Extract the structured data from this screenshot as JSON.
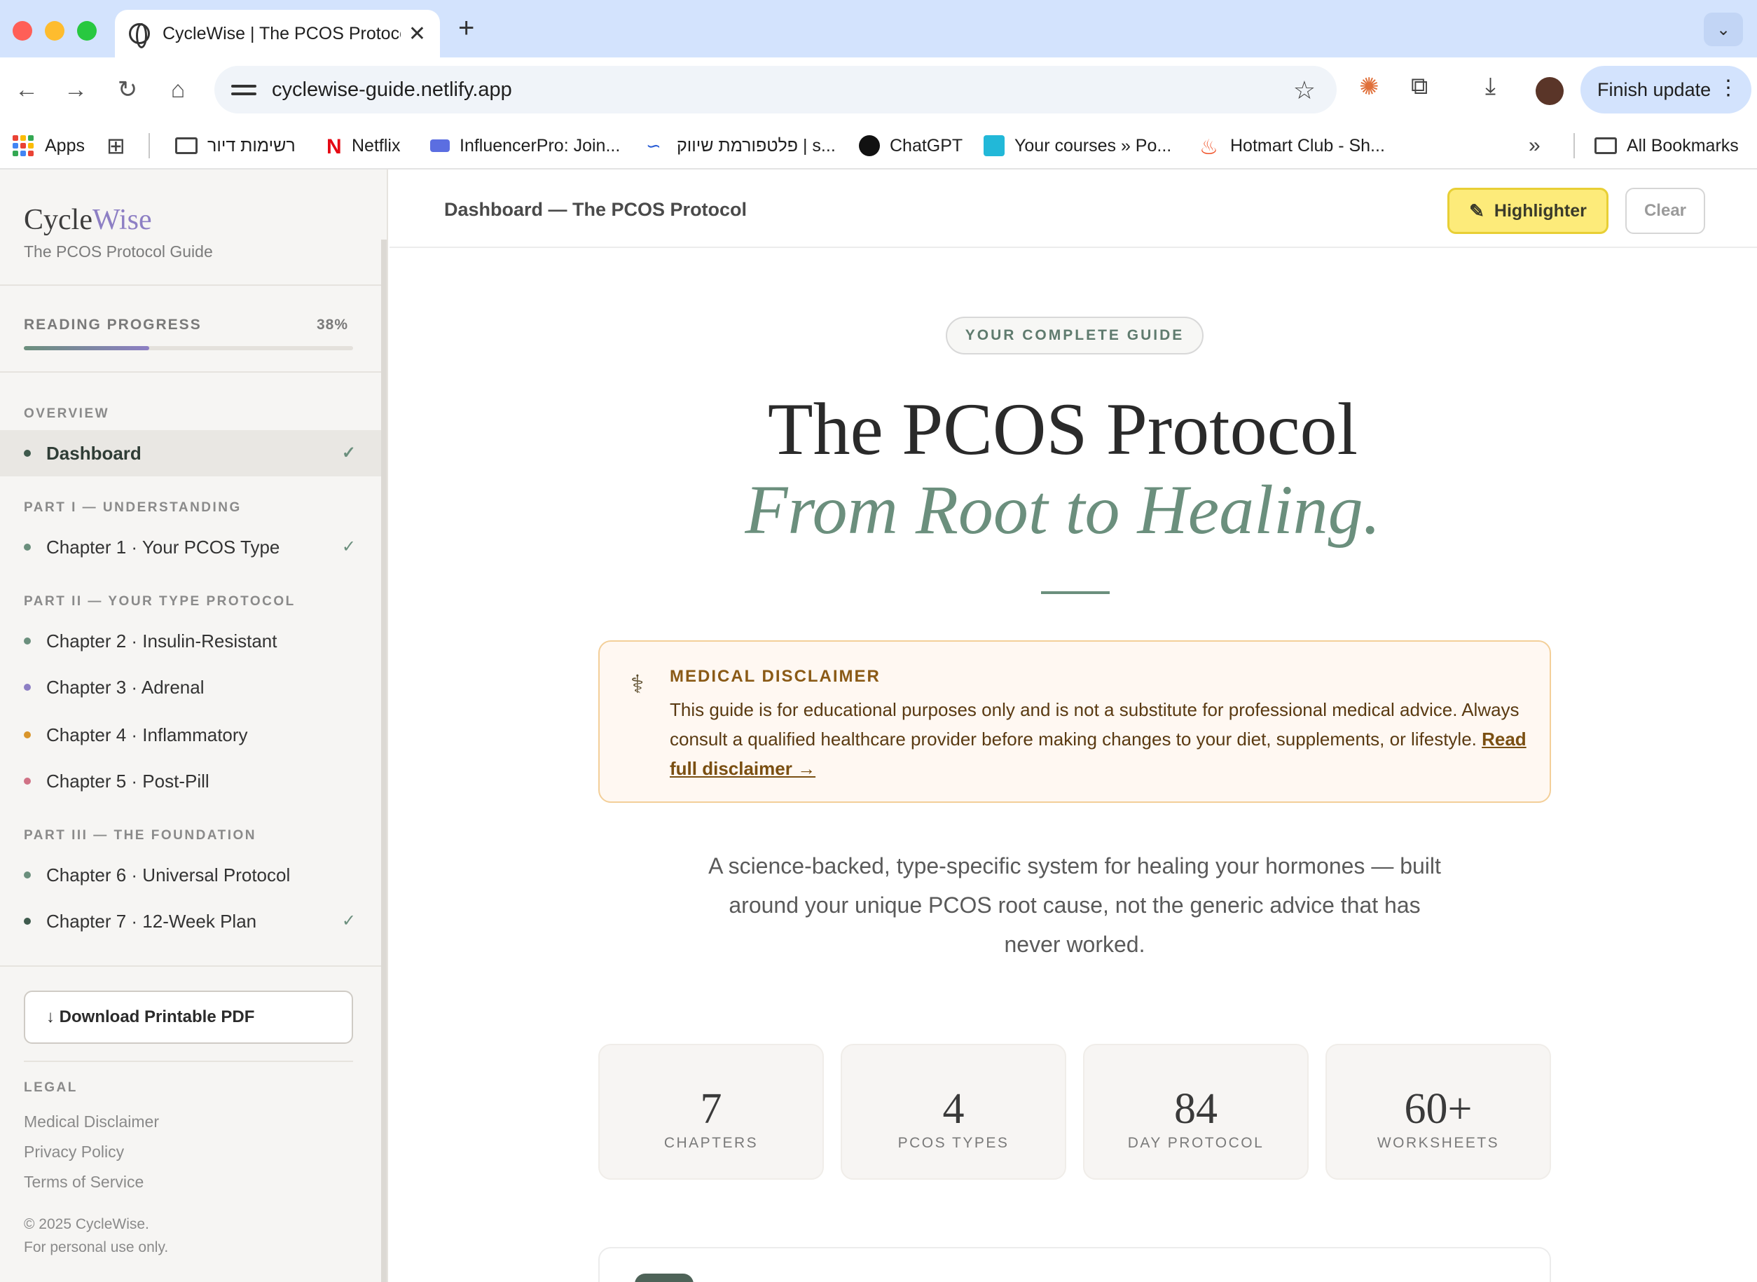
{
  "browser": {
    "tab_title": "CycleWise | The PCOS Protocol",
    "url": "cyclewise-guide.netlify.app",
    "finish_update": "Finish update",
    "bookmarks": [
      {
        "label": "Apps"
      },
      {
        "label": "רשימות דיור"
      },
      {
        "label": "Netflix"
      },
      {
        "label": "InfluencerPro: Join..."
      },
      {
        "label": "פלטפורמת שיווק | s..."
      },
      {
        "label": "ChatGPT"
      },
      {
        "label": "Your courses » Po..."
      },
      {
        "label": "Hotmart Club - Sh..."
      },
      {
        "label": "All Bookmarks"
      }
    ]
  },
  "sidebar": {
    "brand_a": "Cycle",
    "brand_b": "Wise",
    "subtitle": "The PCOS Protocol Guide",
    "progress_label": "READING PROGRESS",
    "progress_text": "38%",
    "progress_value": 0.38,
    "sections": {
      "overview": "OVERVIEW",
      "part1": "PART I — UNDERSTANDING",
      "part2": "PART II — YOUR TYPE PROTOCOL",
      "part3": "PART III — THE FOUNDATION"
    },
    "items": {
      "dashboard": "Dashboard",
      "ch1": "Chapter 1 · Your PCOS Type",
      "ch2": "Chapter 2 · Insulin-Resistant",
      "ch3": "Chapter 3 · Adrenal",
      "ch4": "Chapter 4 · Inflammatory",
      "ch5": "Chapter 5 · Post-Pill",
      "ch6": "Chapter 6 · Universal Protocol",
      "ch7": "Chapter 7 · 12-Week Plan"
    },
    "colors": {
      "sage": "#6b8f7d",
      "purple": "#8d7fc4",
      "amber": "#d9952b",
      "rose": "#d07285"
    },
    "check": "✓",
    "pdf_button": "↓ Download Printable PDF",
    "legal_heading": "LEGAL",
    "legal_links": [
      "Medical Disclaimer",
      "Privacy Policy",
      "Terms of Service"
    ],
    "copyright": "© 2025 CycleWise.",
    "personal_use": "For personal use only."
  },
  "main": {
    "header_title": "Dashboard — The PCOS Protocol",
    "highlighter": "Highlighter",
    "clear": "Clear",
    "pill": "YOUR COMPLETE GUIDE",
    "hero_title": "The PCOS Protocol",
    "hero_subtitle": "From Root to Healing.",
    "disclaimer": {
      "title": "MEDICAL DISCLAIMER",
      "body": "This guide is for educational purposes only and is not a substitute for professional medical advice. Always consult a qualified healthcare provider before making changes to your diet, supplements, or lifestyle.",
      "link": "Read full disclaimer →"
    },
    "intro": "A science-backed, type-specific system for healing your hormones — built around your unique PCOS root cause, not the generic advice that has never worked.",
    "stats": [
      {
        "num": "7",
        "label": "CHAPTERS"
      },
      {
        "num": "4",
        "label": "PCOS TYPES"
      },
      {
        "num": "84",
        "label": "DAY PROTOCOL"
      },
      {
        "num": "60+",
        "label": "WORKSHEETS"
      }
    ]
  }
}
